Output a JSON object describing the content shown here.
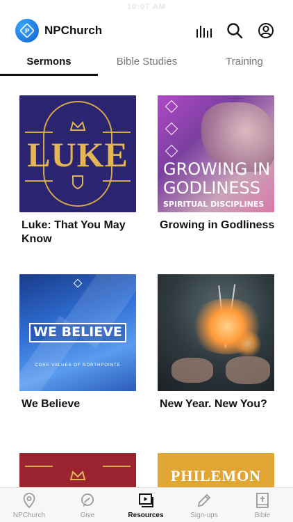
{
  "status": {
    "time": "10:07 AM"
  },
  "header": {
    "title": "NPChurch",
    "icons": [
      "equalizer-icon",
      "search-icon",
      "account-icon"
    ]
  },
  "tabs": [
    {
      "label": "Sermons",
      "active": true
    },
    {
      "label": "Bible Studies",
      "active": false
    },
    {
      "label": "Training",
      "active": false
    }
  ],
  "cards": [
    {
      "title": "Luke: That You May Know",
      "thumb_text": "LUKE"
    },
    {
      "title": "Growing in Godliness",
      "thumb_text_1": "GROWING IN",
      "thumb_text_2": "GODLINESS",
      "thumb_text_3": "SPIRITUAL DISCIPLINES"
    },
    {
      "title": "We Believe",
      "thumb_text": "WE BELIEVE",
      "thumb_sub": "CORE VALUES OF NORTHPOINTE"
    },
    {
      "title": "New Year. New You?"
    },
    {
      "thumb_text": ""
    },
    {
      "thumb_text": "PHILEMON"
    }
  ],
  "bottom_nav": [
    {
      "label": "NPChurch",
      "icon": "location-pin-icon",
      "active": false
    },
    {
      "label": "Give",
      "icon": "give-icon",
      "active": false
    },
    {
      "label": "Resources",
      "icon": "media-play-icon",
      "active": true
    },
    {
      "label": "Sign-ups",
      "icon": "pencil-icon",
      "active": false
    },
    {
      "label": "Bible",
      "icon": "bible-icon",
      "active": false
    }
  ],
  "colors": {
    "accent": "#111111",
    "inactive": "#9a9a9a",
    "logo": "#1a7be0"
  }
}
